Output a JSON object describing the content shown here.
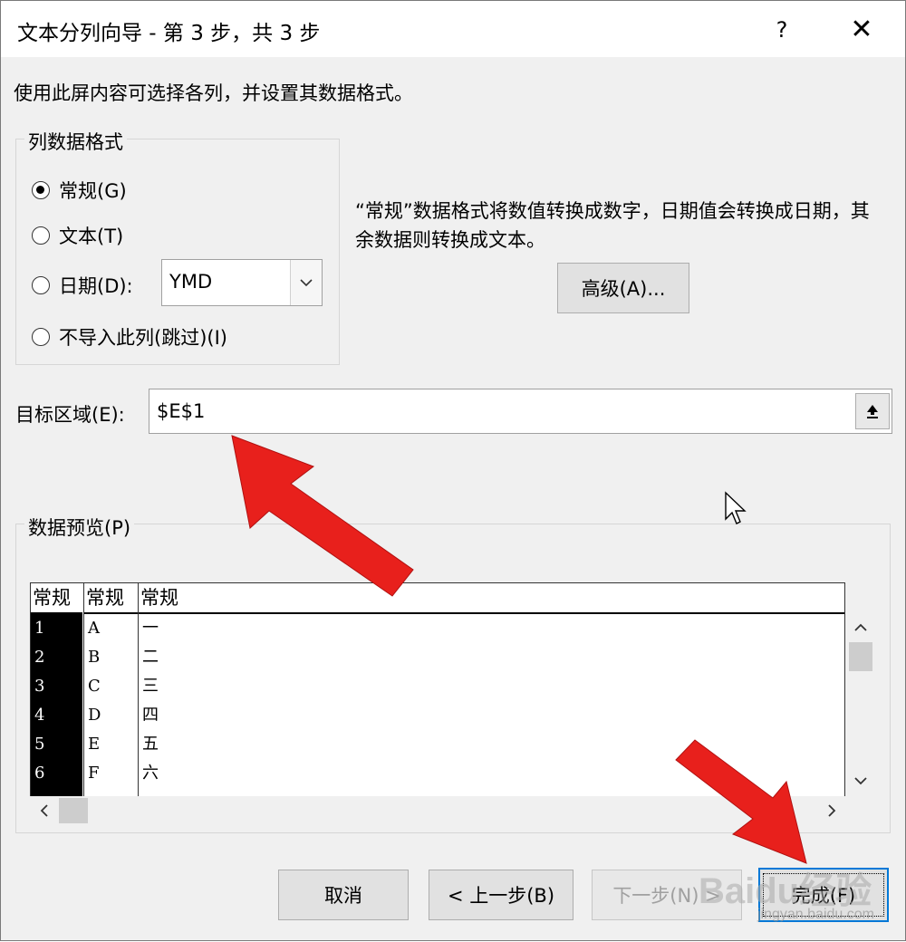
{
  "dialog": {
    "title": "文本分列向导 - 第 3 步，共 3 步",
    "help_label": "?",
    "close_label": "✕",
    "description": "使用此屏内容可选择各列，并设置其数据格式。"
  },
  "column_format": {
    "legend": "列数据格式",
    "options": [
      {
        "label": "常规(G)",
        "checked": true
      },
      {
        "label": "文本(T)",
        "checked": false
      },
      {
        "label": "日期(D):",
        "checked": false
      },
      {
        "label": "不导入此列(跳过)(I)",
        "checked": false
      }
    ],
    "date_format": "YMD"
  },
  "hint_text": "“常规”数据格式将数值转换成数字，日期值会转换成日期，其余数据则转换成文本。",
  "advanced_label": "高级(A)...",
  "target": {
    "label": "目标区域(E):",
    "value": "$E$1"
  },
  "preview": {
    "label": "数据预览(P)",
    "headers": [
      "常规",
      "常规",
      "常规"
    ],
    "columns": [
      [
        "1",
        "2",
        "3",
        "4",
        "5",
        "6"
      ],
      [
        "A",
        "B",
        "C",
        "D",
        "E",
        "F"
      ],
      [
        "一",
        "二",
        "三",
        "四",
        "五",
        "六"
      ]
    ]
  },
  "buttons": {
    "cancel": "取消",
    "back": "< 上一步(B)",
    "next": "下一步(N) >",
    "finish": "完成(F)"
  },
  "watermark": {
    "brand": "Baidu经验",
    "url": "jingyan.baidu.com"
  },
  "colors": {
    "arrow": "#e8201c",
    "dialog_bg": "#f0f0f0",
    "finish_border": "#0078d7"
  },
  "icons": [
    "help-icon",
    "close-icon",
    "chevron-down-icon",
    "collapse-dialog-icon",
    "scroll-up-icon",
    "scroll-down-icon",
    "scroll-left-icon",
    "scroll-right-icon",
    "mouse-cursor-icon",
    "red-arrow-annotation"
  ]
}
